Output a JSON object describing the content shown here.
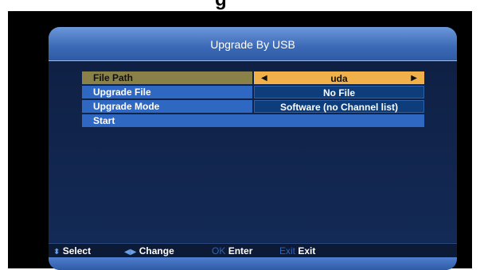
{
  "header_clip": "g",
  "title": "Upgrade By USB",
  "rows": [
    {
      "label": "File Path",
      "value": "uda"
    },
    {
      "label": "Upgrade File",
      "value": "No File"
    },
    {
      "label": "Upgrade Mode",
      "value": "Software (no Channel list)"
    }
  ],
  "start_label": "Start",
  "arrows": {
    "left": "◀",
    "right": "▶"
  },
  "help": {
    "select_icon": "⬍",
    "select_label": "Select",
    "change_icon": "◀▶",
    "change_label": "Change",
    "ok_key": "OK",
    "ok_label": "Enter",
    "exit_key": "Exit",
    "exit_label": "Exit"
  },
  "colors": {
    "highlight": "#f0b14a",
    "row_blue": "#2f68c2",
    "panel_bg": "#10244d"
  }
}
